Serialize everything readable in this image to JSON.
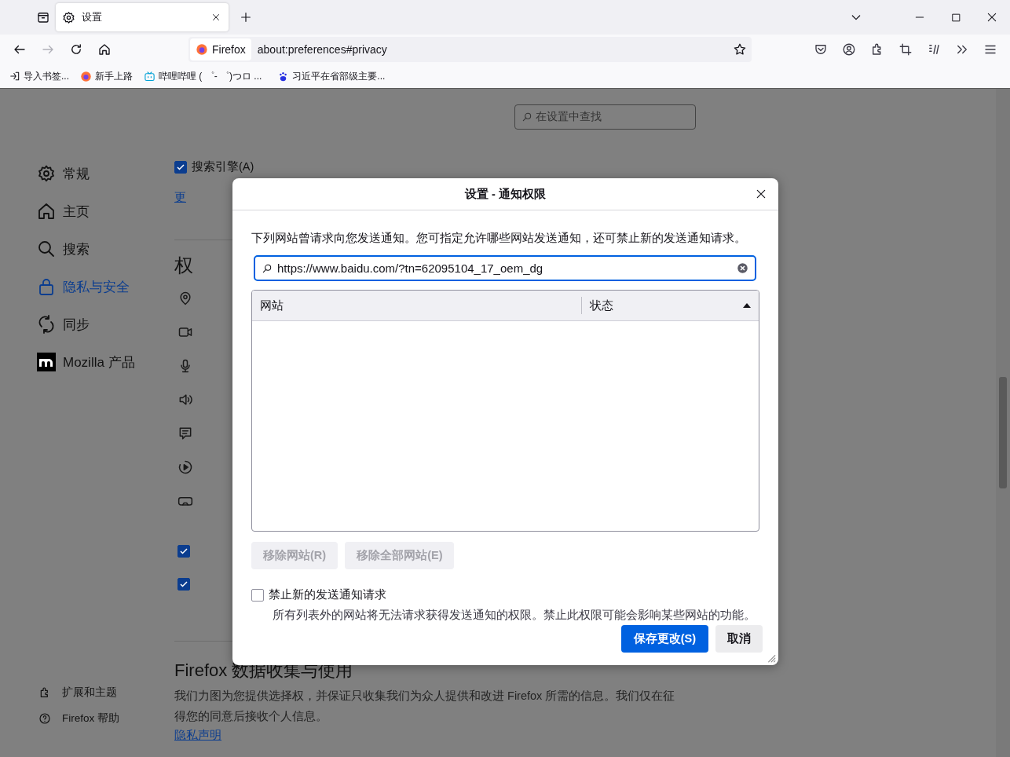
{
  "window": {
    "tabs": [
      {
        "title": "设置",
        "selected": true
      }
    ]
  },
  "navigation": {
    "identity_label": "Firefox",
    "url": "about:preferences#privacy"
  },
  "bookmarks": [
    {
      "label": "导入书签..."
    },
    {
      "label": "新手上路"
    },
    {
      "label": "哔哩哔哩 ( ゜- ゜)つロ ..."
    },
    {
      "label": "习近平在省部级主要..."
    }
  ],
  "settings_search": {
    "placeholder": "在设置中查找"
  },
  "sidebar": {
    "items": [
      {
        "label": "常规",
        "selected": false
      },
      {
        "label": "主页",
        "selected": false
      },
      {
        "label": "搜索",
        "selected": false
      },
      {
        "label": "隐私与安全",
        "selected": true
      },
      {
        "label": "同步",
        "selected": false
      },
      {
        "label": "Mozilla 产品",
        "selected": false
      }
    ],
    "footer": [
      {
        "label": "扩展和主题"
      },
      {
        "label": "Firefox 帮助"
      }
    ]
  },
  "page": {
    "search_engine": {
      "label": "搜索引擎(A)",
      "checked": true
    },
    "change_link": "更",
    "permissions_heading": "权",
    "checkboxes": [
      {
        "checked": true
      },
      {
        "checked": true
      }
    ],
    "data_collection": {
      "heading": "Firefox 数据收集与使用",
      "text": "我们力图为您提供选择权，并保证只收集我们为众人提供和改进 Firefox 所需的信息。我们仅在征得您的同意后接收个人信息。",
      "link": "隐私声明"
    }
  },
  "dialog": {
    "title": "设置 - 通知权限",
    "description": "下列网站曾请求向您发送通知。您可指定允许哪些网站发送通知，还可禁止新的发送通知请求。",
    "search_value": "https://www.baidu.com/?tn=62095104_17_oem_dg",
    "columns": [
      {
        "label": "网站",
        "sorted": false
      },
      {
        "label": "状态",
        "sorted": true
      }
    ],
    "remove_buttons": [
      {
        "label": "移除网站(R)",
        "disabled": true
      },
      {
        "label": "移除全部网站(E)",
        "disabled": true
      }
    ],
    "block_new": {
      "label": "禁止新的发送通知请求",
      "checked": false,
      "note": "所有列表外的网站将无法请求获得发送通知的权限。禁止此权限可能会影响某些网站的功能。"
    },
    "actions": [
      {
        "label": "保存更改(S)",
        "kind": "primary"
      },
      {
        "label": "取消",
        "kind": "secondary"
      }
    ]
  }
}
